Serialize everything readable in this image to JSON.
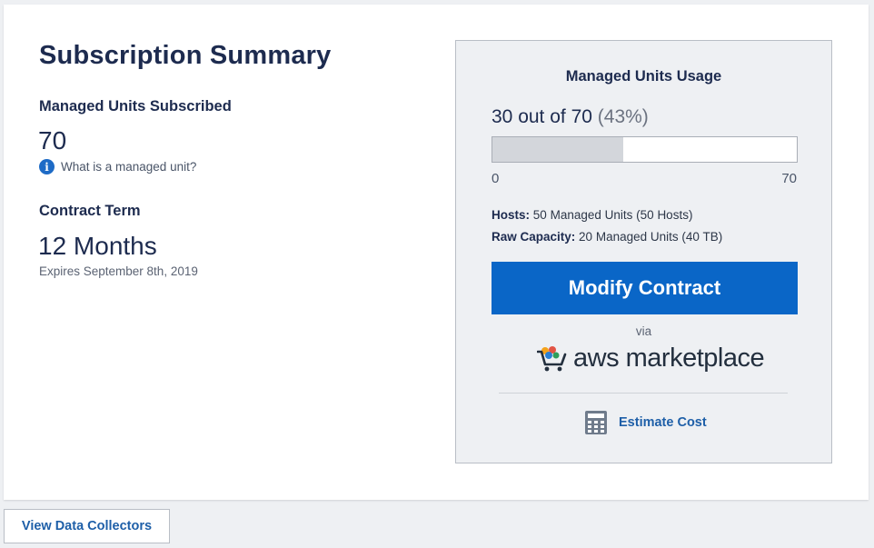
{
  "summary": {
    "title": "Subscription Summary",
    "units_label": "Managed Units Subscribed",
    "units_value": "70",
    "help_link": "What is a managed unit?",
    "term_label": "Contract Term",
    "term_value": "12 Months",
    "expires": "Expires September 8th, 2019"
  },
  "usage": {
    "title": "Managed Units Usage",
    "used_text": "30 out of 70",
    "percent_text": "(43%)",
    "used": 30,
    "total": 70,
    "bar_min": "0",
    "bar_max": "70",
    "hosts_label": "Hosts:",
    "hosts_units": "50",
    "hosts_units_suffix": "Managed Units (",
    "hosts_count": "50",
    "hosts_count_suffix": "Hosts)",
    "raw_label": "Raw Capacity:",
    "raw_units": "20",
    "raw_units_suffix": "Managed Units (",
    "raw_amount": "40",
    "raw_amount_suffix": "TB)",
    "modify_button": "Modify Contract",
    "via": "via",
    "marketplace": "aws marketplace",
    "estimate": "Estimate Cost"
  },
  "footer": {
    "collectors_button": "View Data Collectors"
  },
  "colors": {
    "primary_button": "#0a66c7",
    "link": "#1e5fa8",
    "heading": "#1d2b4f",
    "info_icon": "#1e6bc6"
  },
  "icons": [
    "info-icon",
    "aws-cart-icon",
    "calculator-icon"
  ]
}
